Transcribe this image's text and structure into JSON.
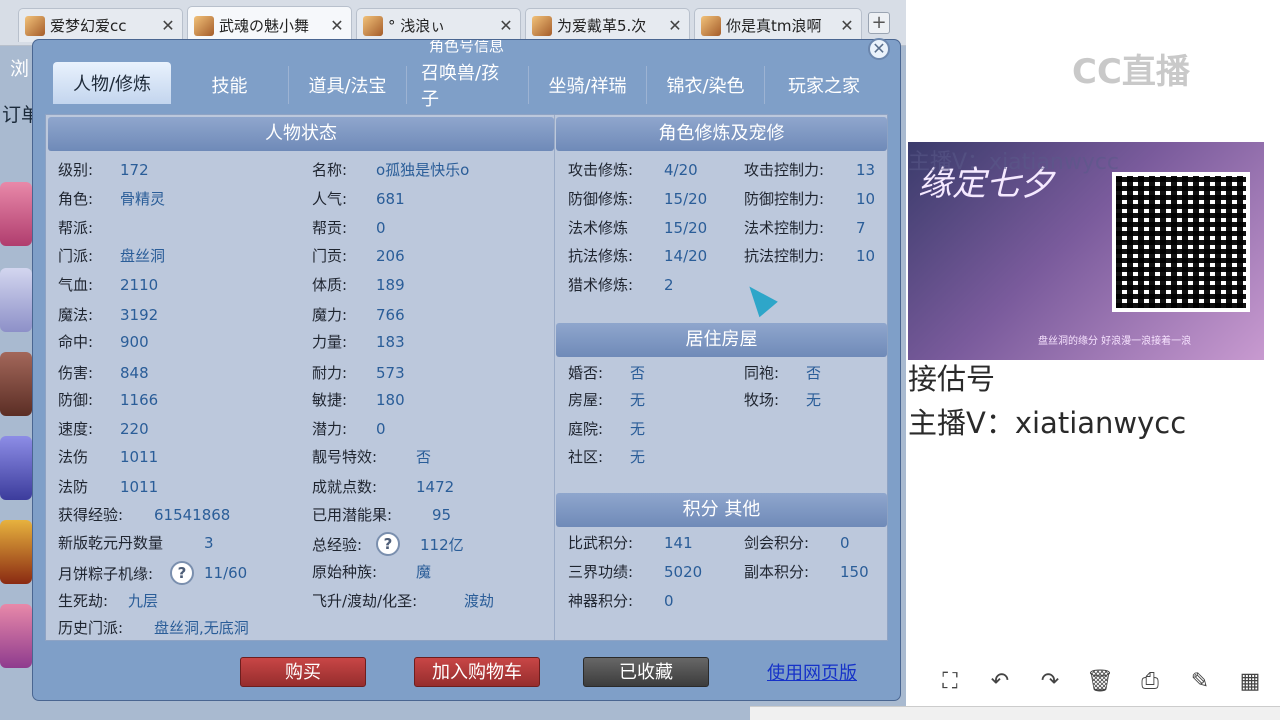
{
  "browser": {
    "tabs": [
      {
        "label": "爱梦幻爱cc"
      },
      {
        "label": "武魂の魅小舞"
      },
      {
        "label": "° 浅浪ぃ"
      },
      {
        "label": "为爱戴革5.次"
      },
      {
        "label": "你是真tm浪啊"
      }
    ],
    "close_glyph": "✕",
    "new_tab_glyph": "+",
    "left_text_1": "浏",
    "left_text_2": "订单"
  },
  "window": {
    "title": "角色号信息",
    "close_glyph": "✕",
    "nav_tabs": [
      "人物/修炼",
      "技能",
      "道具/法宝",
      "召唤兽/孩子",
      "坐骑/祥瑞",
      "锦衣/染色",
      "玩家之家"
    ]
  },
  "status": {
    "header": "人物状态",
    "left": [
      {
        "label": "级别:",
        "value": "172"
      },
      {
        "label": "角色:",
        "value": "骨精灵"
      },
      {
        "label": "帮派:",
        "value": ""
      },
      {
        "label": "门派:",
        "value": "盘丝洞"
      },
      {
        "label": "气血:",
        "value": "2110"
      },
      {
        "label": "魔法:",
        "value": "3192"
      },
      {
        "label": "命中:",
        "value": "900"
      },
      {
        "label": "伤害:",
        "value": "848"
      },
      {
        "label": "防御:",
        "value": "1166"
      },
      {
        "label": "速度:",
        "value": "220"
      },
      {
        "label": "法伤",
        "value": "1011"
      },
      {
        "label": "法防",
        "value": "1011"
      },
      {
        "label": "获得经验:",
        "value": "61541868"
      },
      {
        "label": "新版乾元丹数量",
        "value": "3"
      },
      {
        "label": "月饼粽子机缘:",
        "value": "11/60"
      },
      {
        "label": "生死劫:",
        "value": "九层"
      },
      {
        "label": "历史门派:",
        "value": "盘丝洞,无底洞"
      }
    ],
    "right": [
      {
        "label": "名称:",
        "value": "o孤独是快乐o"
      },
      {
        "label": "人气:",
        "value": "681"
      },
      {
        "label": "帮贡:",
        "value": "0"
      },
      {
        "label": "门贡:",
        "value": "206"
      },
      {
        "label": "体质:",
        "value": "189"
      },
      {
        "label": "魔力:",
        "value": "766"
      },
      {
        "label": "力量:",
        "value": "183"
      },
      {
        "label": "耐力:",
        "value": "573"
      },
      {
        "label": "敏捷:",
        "value": "180"
      },
      {
        "label": "潜力:",
        "value": "0"
      },
      {
        "label": "靓号特效:",
        "value": "否"
      },
      {
        "label": "成就点数:",
        "value": "1472"
      },
      {
        "label": "已用潜能果:",
        "value": "95"
      },
      {
        "label": "总经验:",
        "value": "112亿"
      },
      {
        "label": "原始种族:",
        "value": "魔"
      },
      {
        "label": "飞升/渡劫/化圣:",
        "value": "渡劫"
      }
    ],
    "help_glyph": "?"
  },
  "cultivation": {
    "header": "角色修炼及宠修",
    "left": [
      {
        "label": "攻击修炼:",
        "value": "4/20"
      },
      {
        "label": "防御修炼:",
        "value": "15/20"
      },
      {
        "label": "法术修炼",
        "value": "15/20"
      },
      {
        "label": "抗法修炼:",
        "value": "14/20"
      },
      {
        "label": "猎术修炼:",
        "value": "2"
      }
    ],
    "right": [
      {
        "label": "攻击控制力:",
        "value": "13"
      },
      {
        "label": "防御控制力:",
        "value": "10"
      },
      {
        "label": "法术控制力:",
        "value": "7"
      },
      {
        "label": "抗法控制力:",
        "value": "10"
      }
    ]
  },
  "housing": {
    "header": "居住房屋",
    "left": [
      {
        "label": "婚否:",
        "value": "否"
      },
      {
        "label": "房屋:",
        "value": "无"
      },
      {
        "label": "庭院:",
        "value": "无"
      },
      {
        "label": "社区:",
        "value": "无"
      }
    ],
    "right": [
      {
        "label": "同袍:",
        "value": "否"
      },
      {
        "label": "牧场:",
        "value": "无"
      }
    ]
  },
  "points": {
    "header": "积分 其他",
    "left": [
      {
        "label": "比武积分:",
        "value": "141"
      },
      {
        "label": "三界功绩:",
        "value": "5020"
      },
      {
        "label": "神器积分:",
        "value": "0"
      }
    ],
    "right": [
      {
        "label": "剑会积分:",
        "value": "0"
      },
      {
        "label": "副本积分:",
        "value": "150"
      }
    ]
  },
  "actions": {
    "buy": "购买",
    "add_cart": "加入购物车",
    "saved": "已收藏",
    "web_link": "使用网页版"
  },
  "stream": {
    "logo": "CC直播",
    "banner_title": "缘定七夕",
    "banner_sub": "盘丝洞的缘分 好浪漫一浪接着一浪",
    "watermark": "主播V：xiatianwycc",
    "line1": "接估号",
    "line2": "主播V：xiatianwycc"
  },
  "colors": {
    "window_bg": "#7f9fc8",
    "panel_bg": "#bcc8dc",
    "value_blue": "#2a5d98",
    "buy_red": "#b13a3a"
  }
}
